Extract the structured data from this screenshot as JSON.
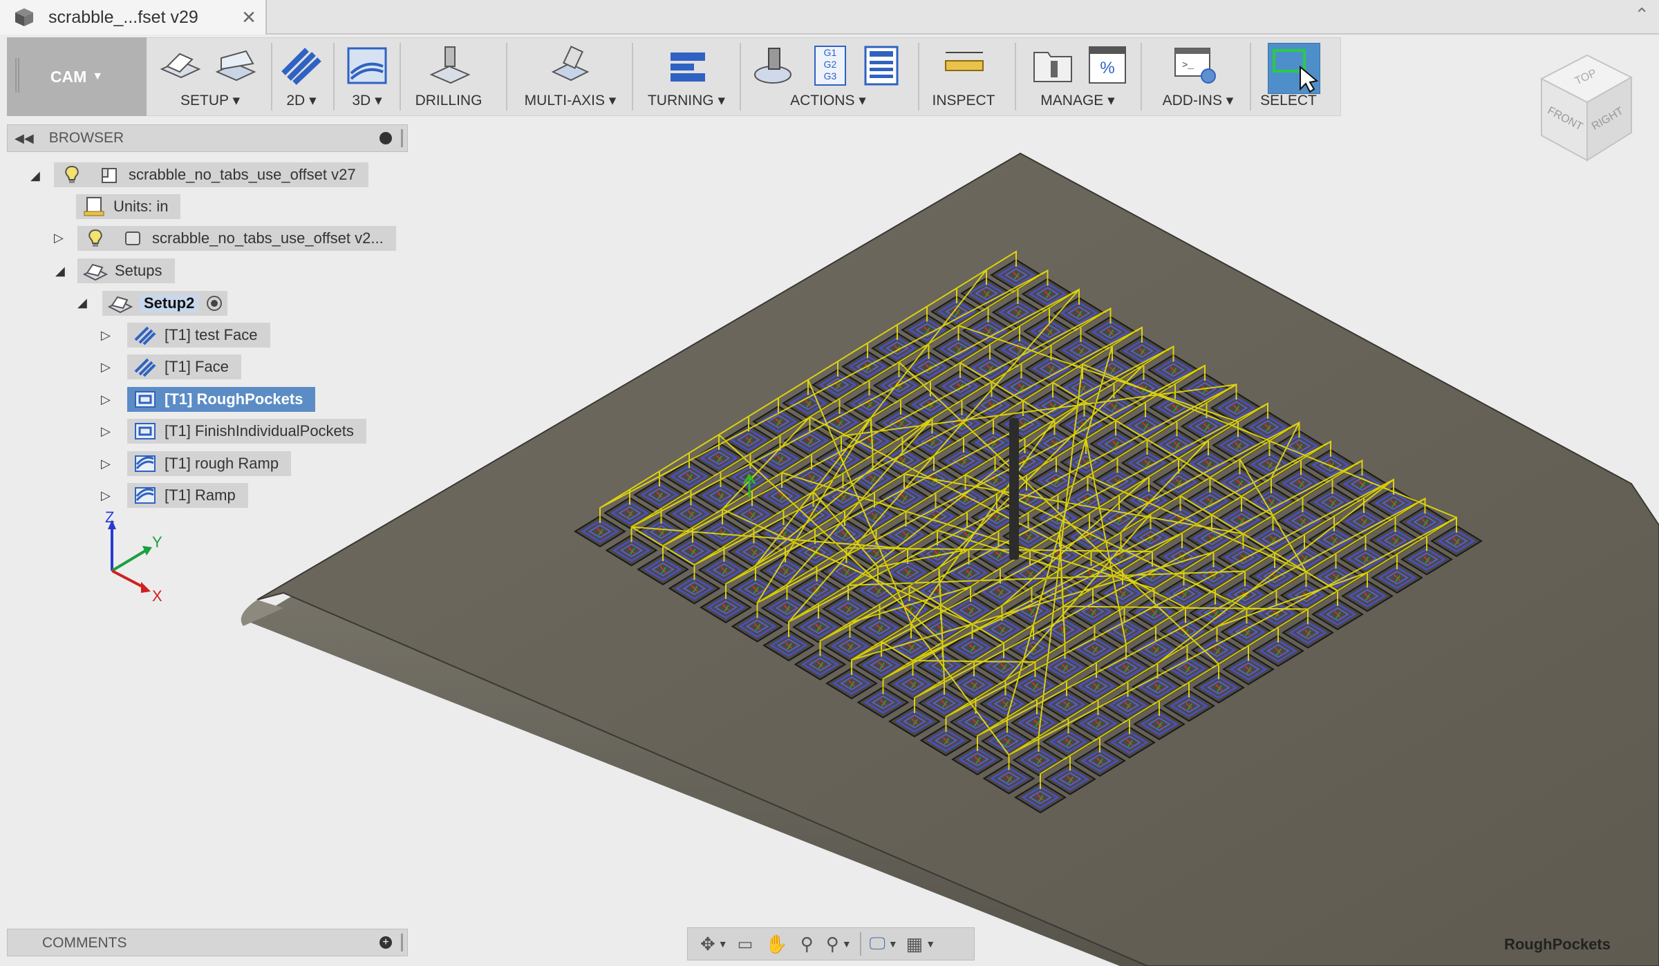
{
  "window": {
    "tab_title": "scrabble_...fset v29"
  },
  "toolbar": {
    "workspace": "CAM",
    "groups": {
      "setup": "SETUP",
      "g2d": "2D",
      "g3d": "3D",
      "drilling": "DRILLING",
      "multiaxis": "MULTI-AXIS",
      "turning": "TURNING",
      "actions": "ACTIONS",
      "inspect": "INSPECT",
      "manage": "MANAGE",
      "addins": "ADD-INS",
      "select": "SELECT"
    },
    "gcode_lines": [
      "G1",
      "G2",
      "G3"
    ]
  },
  "browser": {
    "header": "BROWSER",
    "root": "scrabble_no_tabs_use_offset v27",
    "units": "Units: in",
    "model": "scrabble_no_tabs_use_offset v2...",
    "setups": "Setups",
    "setup2": "Setup2",
    "operations": [
      {
        "label": "[T1] test Face",
        "icon": "face-icon"
      },
      {
        "label": "[T1] Face",
        "icon": "face-icon"
      },
      {
        "label": "[T1] RoughPockets",
        "icon": "pocket-icon",
        "selected": true
      },
      {
        "label": "[T1] FinishIndividualPockets",
        "icon": "pocket-icon"
      },
      {
        "label": "[T1] rough Ramp",
        "icon": "ramp-icon"
      },
      {
        "label": "[T1] Ramp",
        "icon": "ramp-icon"
      }
    ]
  },
  "axes": {
    "z": "Z",
    "y": "Y",
    "x": "X"
  },
  "viewcube": {
    "top": "TOP",
    "front": "FRONT",
    "right": "RIGHT"
  },
  "comments": {
    "header": "COMMENTS"
  },
  "status": {
    "operation": "RoughPockets"
  },
  "colors": {
    "toolpath": "#f2e600",
    "pocket_loop": "#4a4fb8",
    "plate": "#6b675c",
    "selection": "#5b8cc6"
  }
}
